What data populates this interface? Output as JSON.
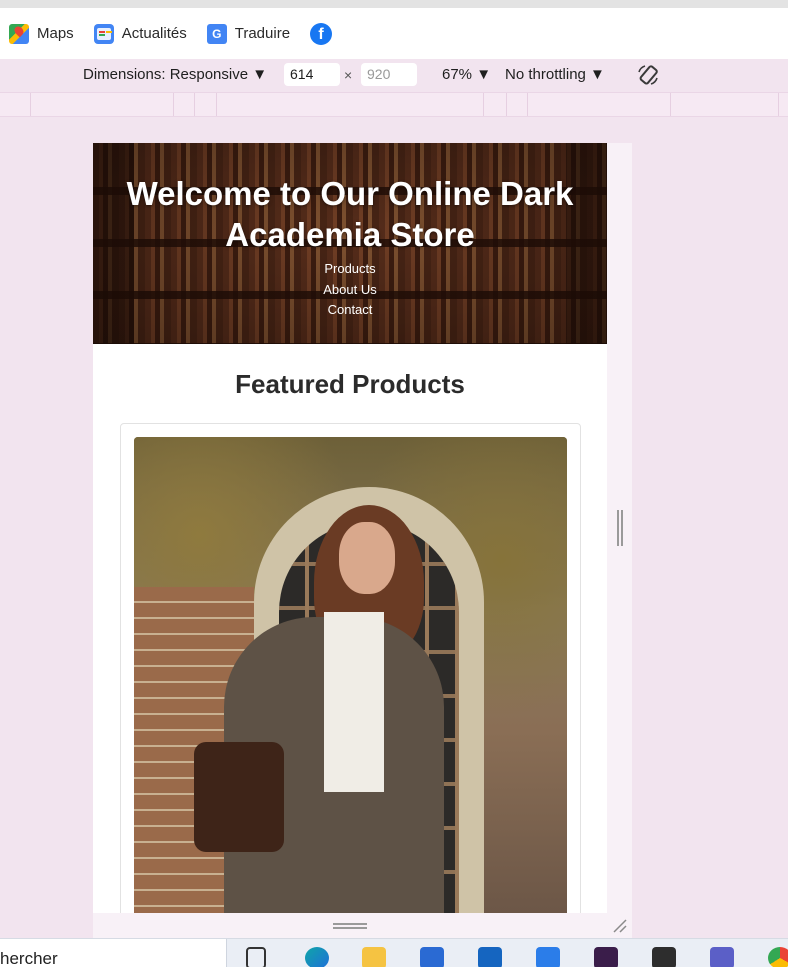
{
  "bookmarks": [
    {
      "label": "Maps",
      "icon": "google-maps-icon"
    },
    {
      "label": "Actualités",
      "icon": "google-news-icon"
    },
    {
      "label": "Traduire",
      "icon": "google-translate-icon"
    },
    {
      "label": "",
      "icon": "facebook-icon"
    }
  ],
  "devtools": {
    "dimensions_label": "Dimensions: Responsive ▼",
    "width_value": "614",
    "times": "×",
    "height_placeholder": "920",
    "zoom": "67% ▼",
    "throttling": "No throttling ▼"
  },
  "site": {
    "hero_title": "Welcome to Our Online Dark Academia Store",
    "nav": [
      "Products",
      "About Us",
      "Contact"
    ],
    "section_title": "Featured Products"
  },
  "taskbar": {
    "search_text": "hercher",
    "apps": [
      "task-view-icon",
      "edge-icon",
      "file-explorer-icon",
      "store-icon",
      "outlook-icon",
      "vscode-icon",
      "app-purple-icon",
      "app-dark-icon",
      "teams-icon",
      "chrome-icon"
    ]
  },
  "colors": {
    "devtools_bg": "#f2e4ef",
    "hero_text": "#ffffff",
    "heading": "#2b2b2b"
  }
}
